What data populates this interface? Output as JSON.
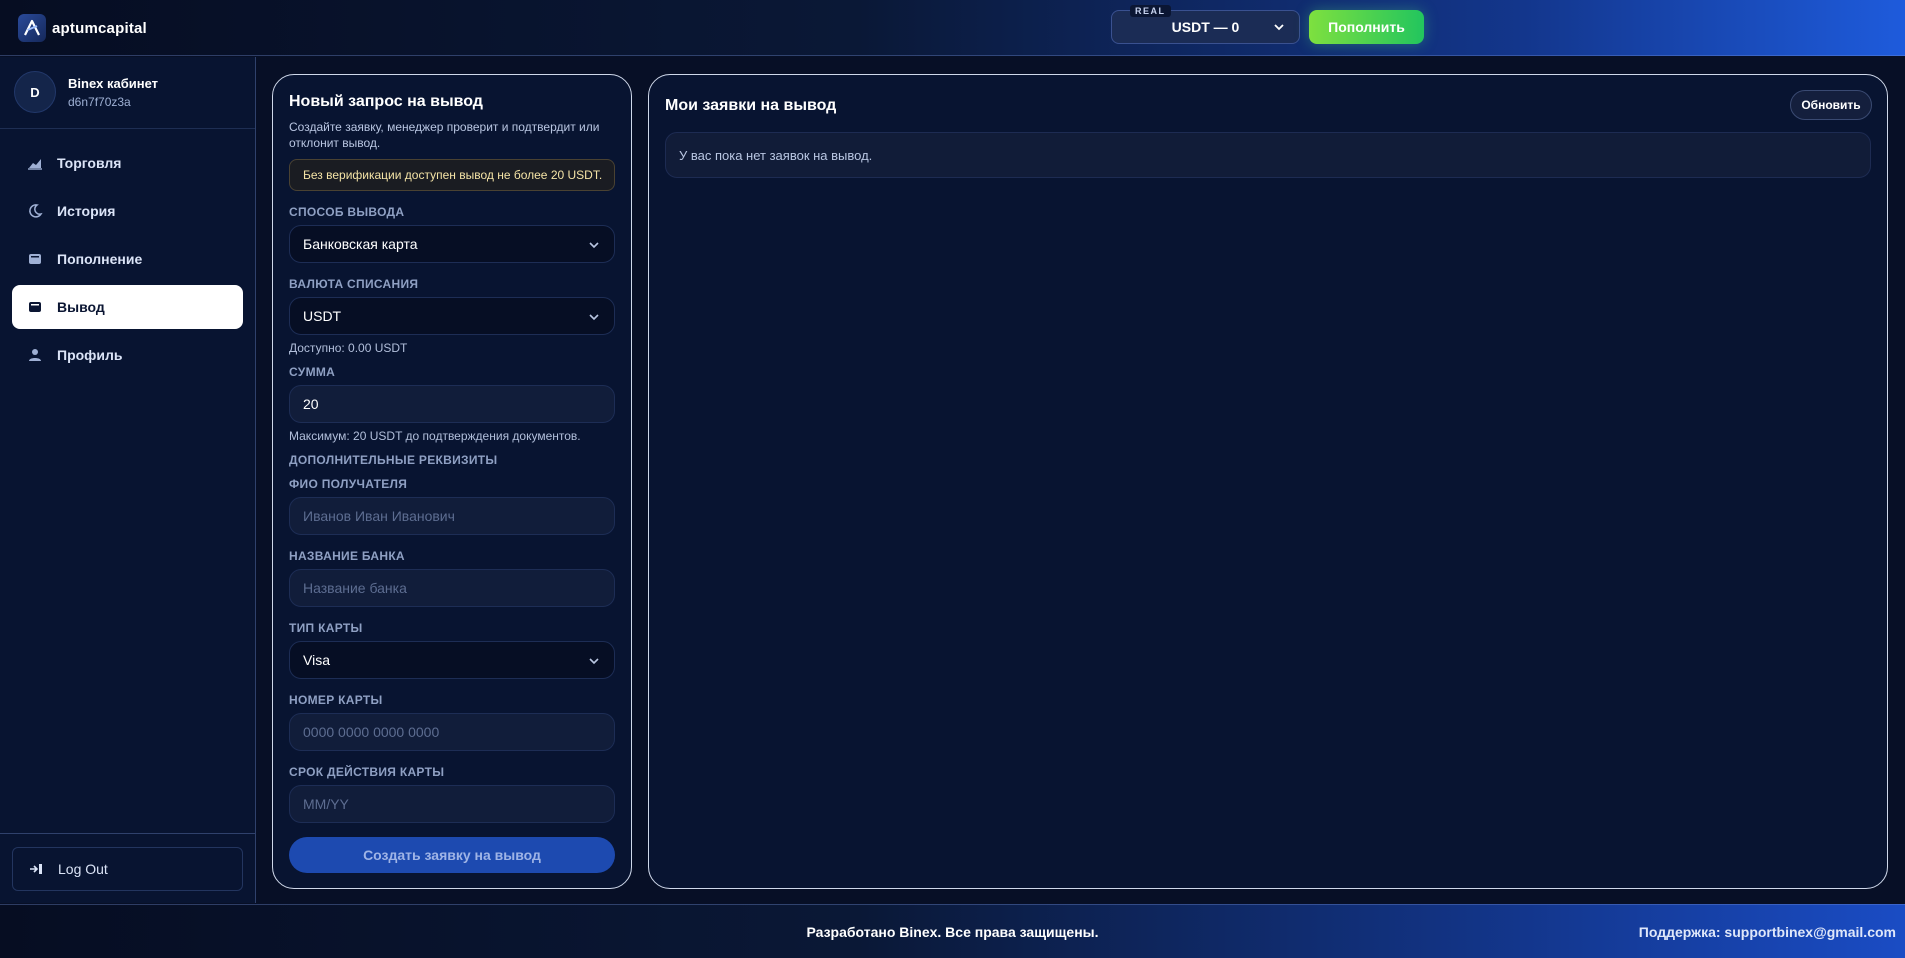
{
  "header": {
    "brand": "aptumcapital",
    "account_badge": "REAL",
    "account_value": "USDT — 0",
    "deposit_label": "Пополнить"
  },
  "sidebar": {
    "avatar_letter": "D",
    "user_name": "Binex кабинет",
    "user_id": "d6n7f70z3a",
    "items": [
      {
        "label": "Торговля",
        "icon": "chart-icon"
      },
      {
        "label": "История",
        "icon": "moon-icon"
      },
      {
        "label": "Пополнение",
        "icon": "wallet-icon"
      },
      {
        "label": "Вывод",
        "icon": "wallet-icon",
        "active": true
      },
      {
        "label": "Профиль",
        "icon": "user-icon"
      }
    ],
    "logout_label": "Log Out"
  },
  "form": {
    "title": "Новый запрос на вывод",
    "description": "Создайте заявку, менеджер проверит и подтвердит или отклонит вывод.",
    "notice": "Без верификации доступен вывод не более 20 USDT.",
    "method_label": "СПОСОБ ВЫВОДА",
    "method_value": "Банковская карта",
    "currency_label": "ВАЛЮТА СПИСАНИЯ",
    "currency_value": "USDT",
    "available_hint": "Доступно: 0.00 USDT",
    "amount_label": "СУММА",
    "amount_value": "20",
    "max_hint": "Максимум: 20 USDT до подтверждения документов.",
    "extra_label": "ДОПОЛНИТЕЛЬНЫЕ РЕКВИЗИТЫ",
    "recipient_label": "ФИО ПОЛУЧАТЕЛЯ",
    "recipient_placeholder": "Иванов Иван Иванович",
    "bank_label": "НАЗВАНИЕ БАНКА",
    "bank_placeholder": "Название банка",
    "card_type_label": "ТИП КАРТЫ",
    "card_type_value": "Visa",
    "card_number_label": "НОМЕР КАРТЫ",
    "card_number_placeholder": "0000 0000 0000 0000",
    "expiry_label": "СРОК ДЕЙСТВИЯ КАРТЫ",
    "expiry_placeholder": "MM/YY",
    "submit_label": "Создать заявку на вывод"
  },
  "requests": {
    "title": "Мои заявки на вывод",
    "refresh_label": "Обновить",
    "empty_text": "У вас пока нет заявок на вывод."
  },
  "footer": {
    "copyright": "Разработано Binex. Все права защищены.",
    "support": "Поддержка: supportbinex@gmail.com"
  },
  "colors": {
    "accent_green": "#22c55e",
    "primary_blue": "#1d4ab0",
    "background": "#070f26"
  }
}
